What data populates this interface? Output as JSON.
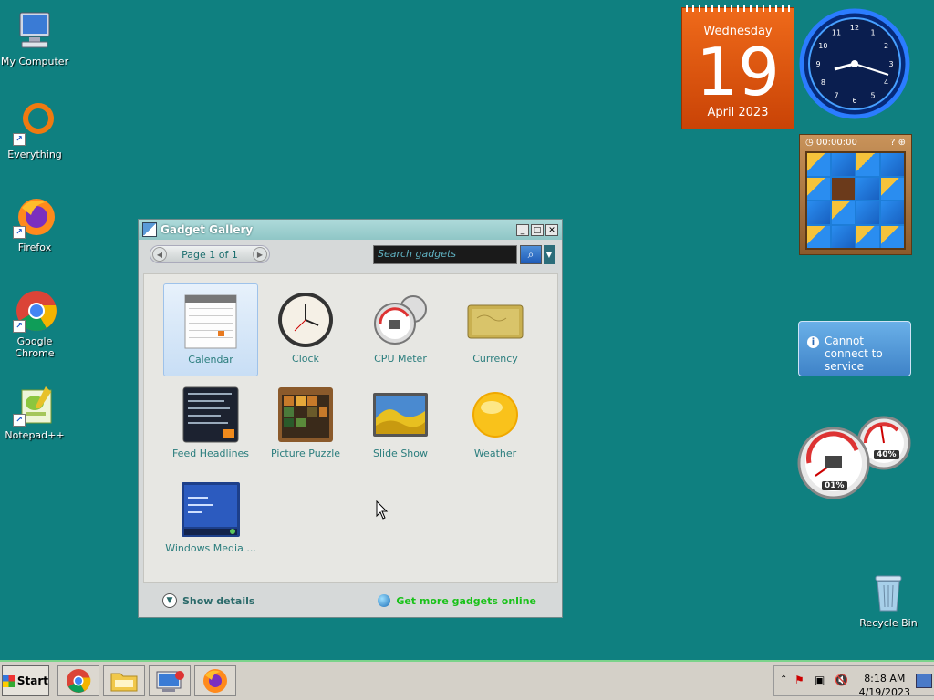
{
  "desktop": {
    "icons": [
      {
        "label": "My Computer",
        "icon": "computer-icon"
      },
      {
        "label": "Everything",
        "icon": "everything-icon"
      },
      {
        "label": "Firefox",
        "icon": "firefox-icon"
      },
      {
        "label": "Google Chrome",
        "icon": "chrome-icon"
      },
      {
        "label": "Notepad++",
        "icon": "notepadpp-icon"
      },
      {
        "label": "Recycle Bin",
        "icon": "recycle-bin-icon"
      }
    ]
  },
  "gallery": {
    "title": "Gadget Gallery",
    "page_label": "Page 1 of 1",
    "search_placeholder": "Search gadgets",
    "items": [
      {
        "name": "Calendar",
        "selected": true
      },
      {
        "name": "Clock"
      },
      {
        "name": "CPU Meter"
      },
      {
        "name": "Currency"
      },
      {
        "name": "Feed Headlines"
      },
      {
        "name": "Picture Puzzle"
      },
      {
        "name": "Slide Show"
      },
      {
        "name": "Weather"
      },
      {
        "name": "Windows Media ..."
      }
    ],
    "show_details": "Show details",
    "get_more": "Get more gadgets online"
  },
  "gadgets": {
    "calendar": {
      "weekday": "Wednesday",
      "day": "19",
      "month_year": "April 2023"
    },
    "clock_numbers": [
      "12",
      "1",
      "2",
      "3",
      "4",
      "5",
      "6",
      "7",
      "8",
      "9",
      "10",
      "11"
    ],
    "puzzle_timer": "00:00:00",
    "notification": "Cannot connect to service",
    "cpu_meter": {
      "cpu": "01%",
      "memory": "40%"
    }
  },
  "taskbar": {
    "start": "Start",
    "time": "8:18 AM",
    "date": "4/19/2023"
  },
  "colors": {
    "desktop": "#0f8080",
    "calendar_orange": "#e45a10",
    "link_green": "#19c219"
  }
}
